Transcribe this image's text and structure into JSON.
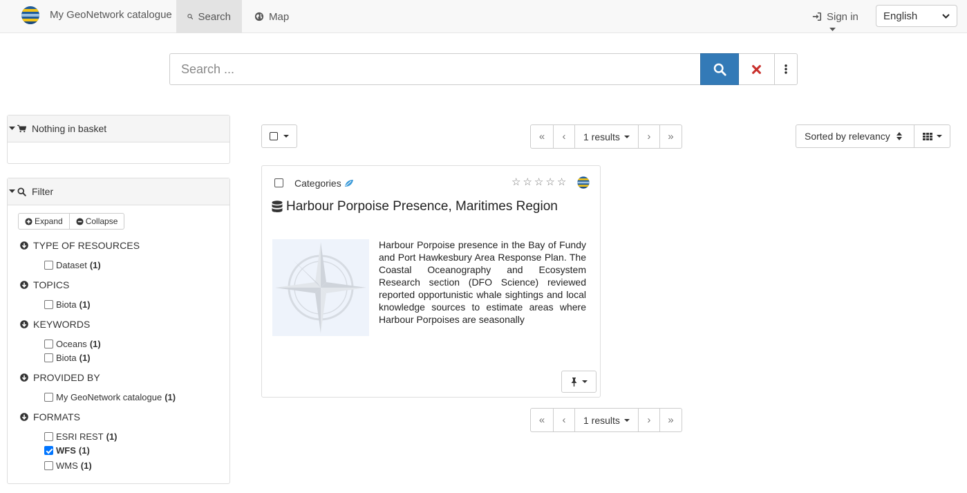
{
  "navbar": {
    "brand": "My GeoNetwork catalogue",
    "search_label": "Search",
    "map_label": "Map",
    "sign_in_label": "Sign in",
    "language": "English"
  },
  "search": {
    "placeholder": "Search ..."
  },
  "basket": {
    "title": "Nothing in basket"
  },
  "filter": {
    "title": "Filter",
    "expand_label": "Expand",
    "collapse_label": "Collapse",
    "facets": [
      {
        "title": "TYPE OF RESOURCES",
        "items": [
          {
            "label": "Dataset",
            "count": "(1)",
            "checked": false
          }
        ]
      },
      {
        "title": "TOPICS",
        "items": [
          {
            "label": "Biota",
            "count": "(1)",
            "checked": false
          }
        ]
      },
      {
        "title": "KEYWORDS",
        "items": [
          {
            "label": "Oceans",
            "count": "(1)",
            "checked": false
          },
          {
            "label": "Biota",
            "count": "(1)",
            "checked": false
          }
        ]
      },
      {
        "title": "PROVIDED BY",
        "items": [
          {
            "label": "My GeoNetwork catalogue",
            "count": "(1)",
            "checked": false
          }
        ]
      },
      {
        "title": "FORMATS",
        "items": [
          {
            "label": "ESRI REST",
            "count": "(1)",
            "checked": false
          },
          {
            "label": "WFS",
            "count": "(1)",
            "checked": true
          },
          {
            "label": "WMS",
            "count": "(1)",
            "checked": false
          }
        ]
      }
    ]
  },
  "results": {
    "pager_label": "1 results",
    "sort_label": "Sorted by relevancy",
    "items": [
      {
        "category": "Categories",
        "title": "Harbour Porpoise Presence, Maritimes Region",
        "abstract": "Harbour Porpoise presence in the Bay of Fundy and Port Hawkesbury Area Response Plan. The Coastal Oceanography and Ecosystem Research section (DFO Science) reviewed reported opportunistic whale sightings and local knowledge sources to estimate areas where Harbour Porpoises are seasonally",
        "rating": 0,
        "rating_max": 5
      }
    ]
  },
  "colors": {
    "primary": "#337ab7",
    "clear": "#c9302c",
    "checkbox": "#0075ff"
  }
}
